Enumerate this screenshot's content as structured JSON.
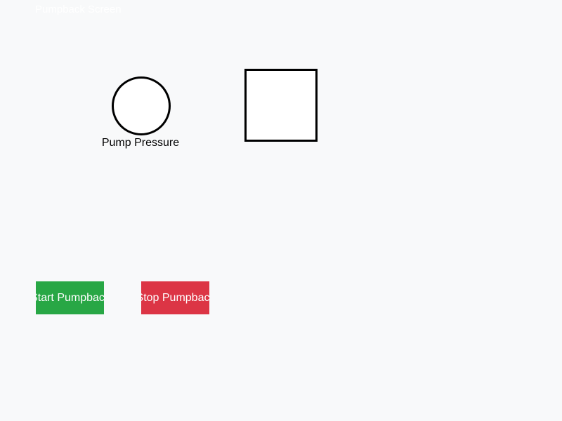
{
  "screen": {
    "title": "Pumpback Screen"
  },
  "gauge": {
    "label": "Pump Pressure"
  },
  "controls": {
    "start_label": "Start Pumpback",
    "stop_label": "Stop Pumpback"
  },
  "colors": {
    "start_button": "#28a745",
    "stop_button": "#dc3545",
    "background": "#f8f9fa",
    "shape_outline": "#000000"
  }
}
